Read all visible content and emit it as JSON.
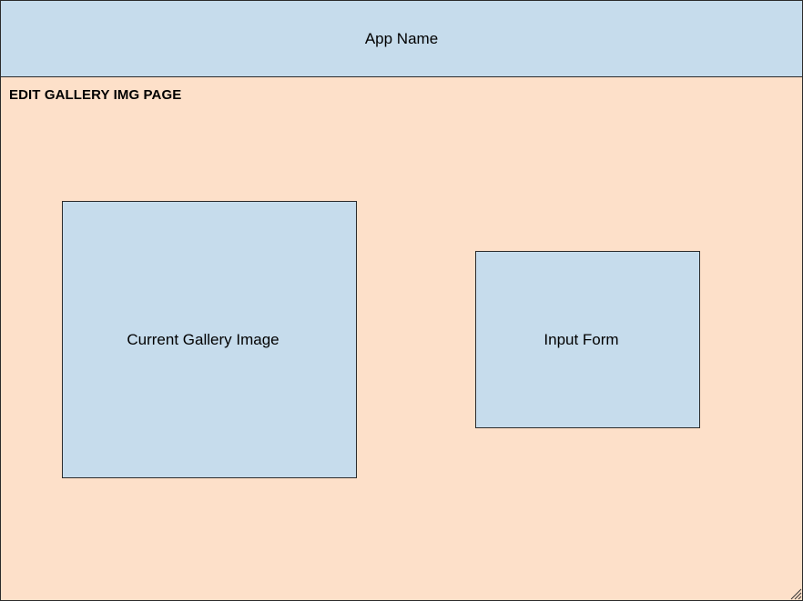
{
  "header": {
    "app_name": "App Name"
  },
  "page": {
    "title": "EDIT GALLERY IMG PAGE"
  },
  "boxes": {
    "gallery_image_label": "Current Gallery Image",
    "input_form_label": "Input Form"
  },
  "colors": {
    "header_fill": "#c6dcec",
    "page_fill": "#fde0c9",
    "box_fill": "#c6dcec",
    "border": "#2b2b2b"
  },
  "icons": {
    "resize_grip": "resize-grip-icon"
  }
}
